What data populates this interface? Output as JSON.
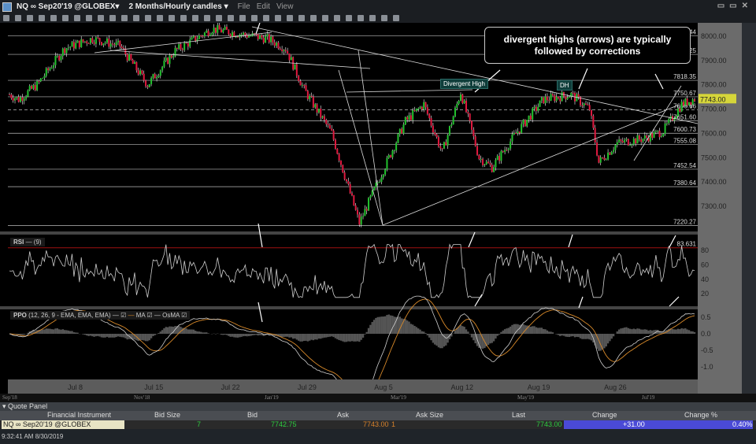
{
  "titlebar": {
    "symbol": "NQ ∞ Sep20'19 @GLOBEX▾",
    "timeframe": "2 Months/Hourly candles ▾",
    "menus": [
      "File",
      "Edit",
      "View"
    ]
  },
  "colors": {
    "up": "#22c32e",
    "down": "#e0193f",
    "rsi_line": "#cfcfcf",
    "ppo_line": "#cfcfcf",
    "ppo_ma": "#d98a2a",
    "osma": "#555555",
    "rsi_ref": "#a01010",
    "last_price_bg": "#d6d63a"
  },
  "annotation": {
    "callout": "divergent highs (arrows) are typically followed by corrections",
    "tag1": "Divergent High",
    "tag2": "DH"
  },
  "price_axis": {
    "ticks": [
      "8000.00",
      "7900.00",
      "7800.00",
      "7700.00",
      "7600.00",
      "7500.00",
      "7400.00",
      "7300.00"
    ],
    "last": "7743.00"
  },
  "levels": [
    "8001.44",
    "7925.25",
    "7818.35",
    "7750.67",
    "7696.66",
    "7651.60",
    "7600.73",
    "7555.08",
    "7452.54",
    "7380.64",
    "7220.27"
  ],
  "rsi": {
    "label": "RSI",
    "params": "(9)",
    "ref_value": "83.631",
    "ticks": [
      "80",
      "60",
      "40",
      "20"
    ]
  },
  "ppo": {
    "label": "PPO",
    "params": "(12, 26, 9 - EMA, EMA, EMA)",
    "ma": "MA",
    "osma": "OsMA",
    "ticks": [
      "0.5",
      "0.0",
      "-0.5",
      "-1.0"
    ]
  },
  "date_axis": [
    "Jul 8",
    "Jul 15",
    "Jul 22",
    "Jul 29",
    "Aug 5",
    "Aug 12",
    "Aug 19",
    "Aug 26"
  ],
  "navigator": [
    "Sep'18",
    "Nov'18",
    "Jan'19",
    "Mar'19",
    "May'19",
    "Jul'19"
  ],
  "quote_panel": {
    "title": "Quote Panel",
    "columns": [
      "Financial Instrument",
      "Bid Size",
      "Bid",
      "Ask",
      "Ask Size",
      "Last",
      "Change",
      "Change %"
    ],
    "row": {
      "instrument": "NQ ∞ Sep20'19 @GLOBEX",
      "bid_size": "7",
      "bid": "7742.75",
      "ask": "7743.00",
      "ask_size": "1",
      "last": "7743.00",
      "change": "+31.00",
      "change_pct": "0.40%"
    }
  },
  "status": "9:32:41 AM 8/30/2019",
  "chart_data": {
    "type": "candlestick",
    "path": [
      [
        0,
        7760
      ],
      [
        5,
        7740
      ],
      [
        15,
        7800
      ],
      [
        30,
        7950
      ],
      [
        45,
        7990
      ],
      [
        60,
        7960
      ],
      [
        75,
        7800
      ],
      [
        90,
        7940
      ],
      [
        110,
        8030
      ],
      [
        125,
        8010
      ],
      [
        140,
        7990
      ],
      [
        150,
        7950
      ],
      [
        160,
        7780
      ],
      [
        175,
        7600
      ],
      [
        190,
        7230
      ],
      [
        200,
        7400
      ],
      [
        215,
        7650
      ],
      [
        225,
        7720
      ],
      [
        235,
        7520
      ],
      [
        245,
        7770
      ],
      [
        255,
        7500
      ],
      [
        262,
        7460
      ],
      [
        275,
        7600
      ],
      [
        290,
        7740
      ],
      [
        305,
        7760
      ],
      [
        315,
        7700
      ],
      [
        320,
        7480
      ],
      [
        330,
        7560
      ],
      [
        345,
        7580
      ],
      [
        355,
        7610
      ],
      [
        365,
        7720
      ],
      [
        372,
        7743
      ]
    ]
  }
}
